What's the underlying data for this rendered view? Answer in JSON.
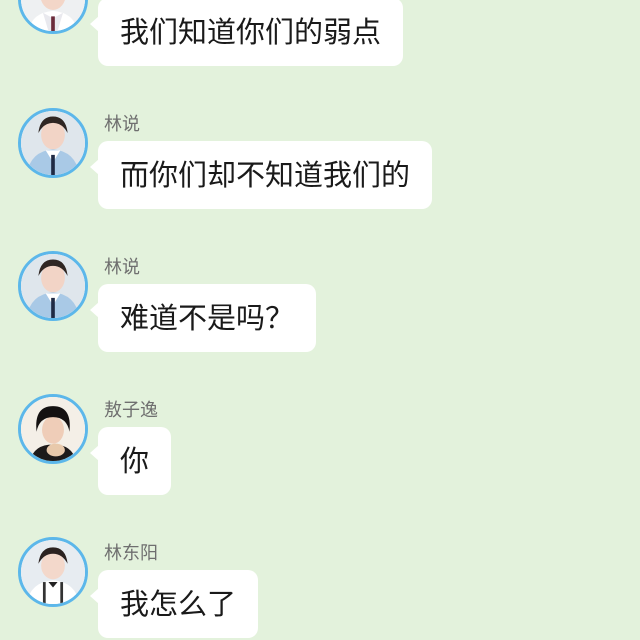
{
  "messages": [
    {
      "avatar_icon": "boy-school-uniform-avatar-icon",
      "sender": "",
      "text": "我们知道你们的弱点"
    },
    {
      "avatar_icon": "boy-school-uniform-avatar-icon",
      "sender": "林说",
      "text": "而你们却不知道我们的"
    },
    {
      "avatar_icon": "boy-school-uniform-avatar-icon",
      "sender": "林说",
      "text": "难道不是吗？"
    },
    {
      "avatar_icon": "dark-hair-boy-avatar-icon",
      "sender": "敖子逸",
      "text": "你"
    },
    {
      "avatar_icon": "boy-suspenders-avatar-icon",
      "sender": "林东阳",
      "text": "我怎么了"
    }
  ],
  "colors": {
    "background": "#e3f2dc",
    "avatar_ring": "#5cb7ea",
    "bubble": "#ffffff",
    "sender_text": "#6f6f6f",
    "message_text": "#1a1a1a"
  }
}
